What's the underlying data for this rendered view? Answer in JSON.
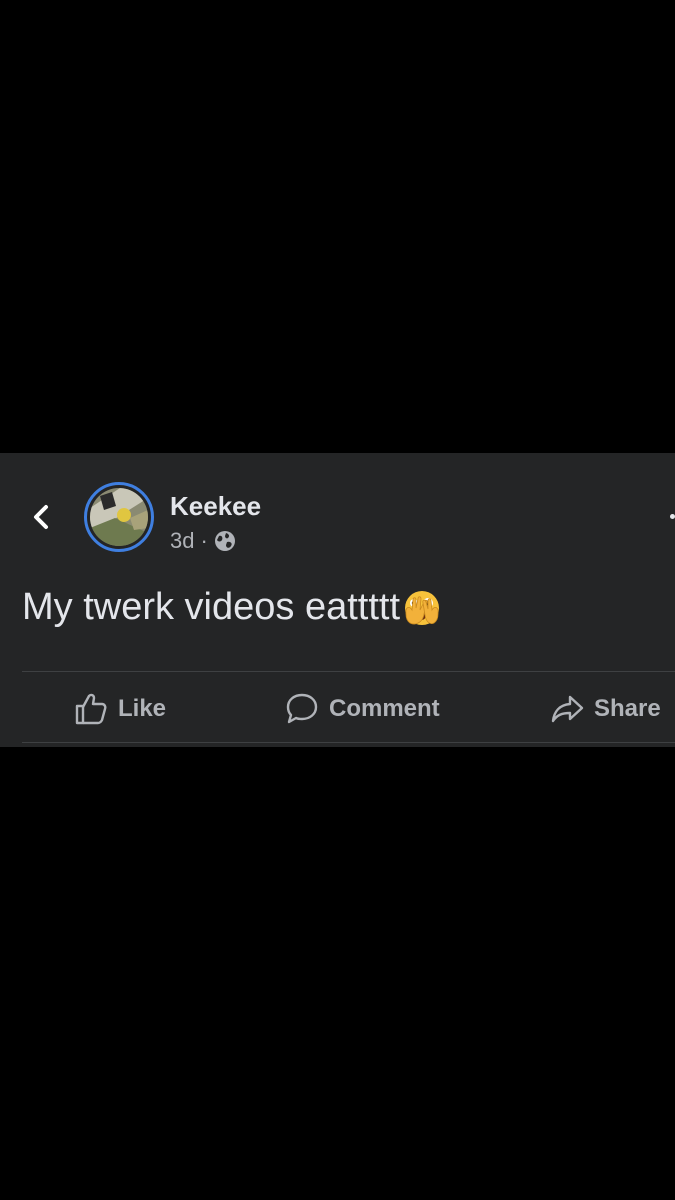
{
  "post": {
    "author": "Keekee",
    "age": "3d",
    "separator": "·",
    "privacy_icon": "globe-icon",
    "text": "My twerk videos eattttt",
    "emoji": "face-with-open-eyes-and-hand-over-mouth-emoji"
  },
  "navigation": {
    "back_icon": "chevron-left-icon"
  },
  "actions": {
    "like_label": "Like",
    "comment_label": "Comment",
    "share_label": "Share"
  },
  "colors": {
    "page_background": "#000000",
    "card_background": "#242526",
    "primary_text": "#e4e6eb",
    "secondary_text": "#b0b3b8",
    "avatar_ring": "#3f7fe0",
    "divider": "#3e4042"
  }
}
